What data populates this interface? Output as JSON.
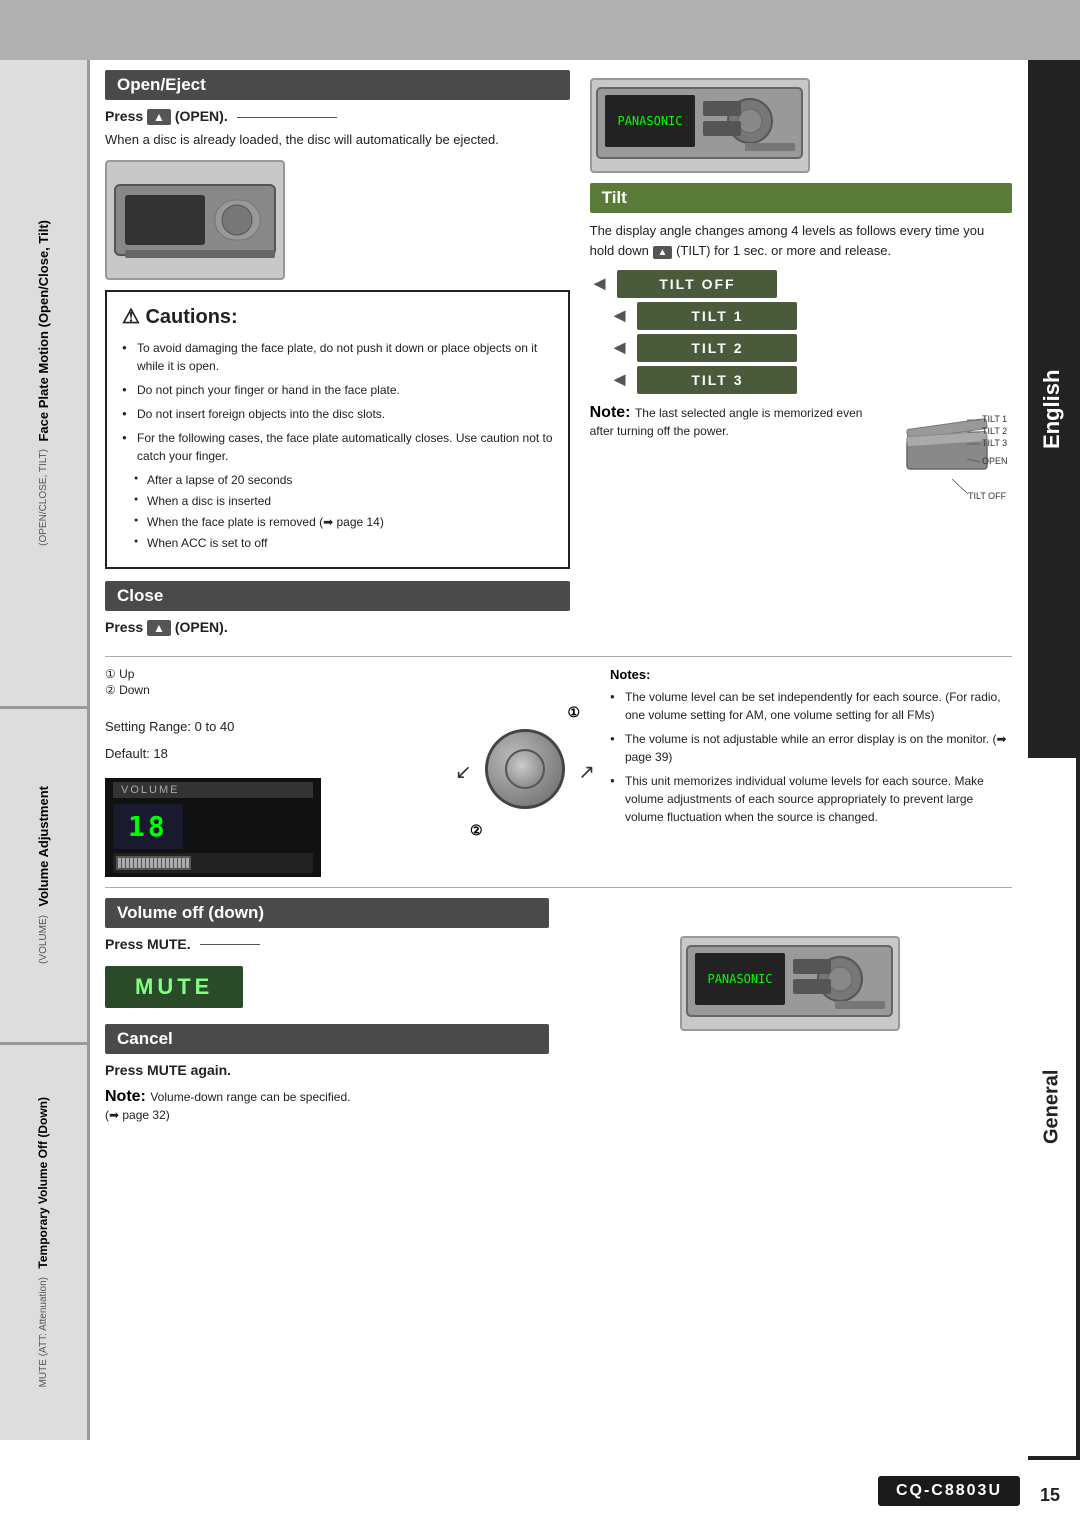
{
  "page": {
    "title": "CQ-C8803U Manual Page 15",
    "page_number": "15",
    "model": "CQ-C8803U"
  },
  "sidebar_right": {
    "english_label": "English",
    "general_label": "General"
  },
  "sidebar_left": {
    "section1_main": "Face Plate Motion (Open/Close, Tilt)",
    "section1_sub": "(OPEN/CLOSE, TILT)",
    "section2_main": "Volume Adjustment",
    "section2_sub": "(VOLUME)",
    "section3_main": "Temporary Volume Off (Down)",
    "section3_sub": "MUTE (ATT: Attenuation)"
  },
  "open_eject": {
    "header": "Open/Eject",
    "press_text": "Press",
    "press_symbol": "▲",
    "press_label": "(OPEN).",
    "body": "When a disc is already loaded, the disc will automatically be ejected."
  },
  "cautions": {
    "title": "⚠ Cautions:",
    "items": [
      "To avoid damaging the face plate, do not push it down or place objects on it while it is open.",
      "Do not pinch your finger or hand in the face plate.",
      "Do not insert foreign objects into the disc slots.",
      "For the following cases, the face plate automatically closes. Use caution not to catch your finger."
    ],
    "sub_items": [
      "After a lapse of 20 seconds",
      "When a disc is inserted",
      "When the face plate is removed (➡ page 14)",
      "When ACC is set to off"
    ]
  },
  "tilt": {
    "header": "Tilt",
    "body": "The display angle changes among 4 levels as follows every time you hold down",
    "body2": "(TILT) for 1 sec. or more and release.",
    "bars": [
      "TILT  OFF",
      "TILT  1",
      "TILT  2",
      "TILT  3"
    ],
    "note_bold": "Note:",
    "note_text": " The last selected angle is memorized even after turning off the power.",
    "tilt_labels": [
      "TILT 1",
      "TILT 2",
      "TILT 3",
      "OPEN",
      "TILT OFF"
    ]
  },
  "close": {
    "header": "Close",
    "press_text": "Press",
    "press_symbol": "▲",
    "press_label": "(OPEN)."
  },
  "volume": {
    "up_label": "① Up",
    "down_label": "② Down",
    "setting_range": "Setting Range: 0 to 40",
    "default": "Default: 18",
    "display_label": "VOLUME",
    "display_value": "18",
    "num1": "①",
    "num2": "②"
  },
  "volume_notes": {
    "bold": "Notes:",
    "items": [
      "The volume level can be set independently for each source. (For radio, one volume setting for AM, one volume setting for all FMs)",
      "The volume is not adjustable while an error display is on the monitor. (➡ page 39)",
      "This unit memorizes individual volume levels for each source. Make volume adjustments of each source appropriately to prevent large volume fluctuation when the source is changed."
    ]
  },
  "volume_off": {
    "header": "Volume off (down)",
    "press_text": "Press",
    "press_bold": "MUTE",
    "press_suffix": ".",
    "display_value": "MUTE"
  },
  "cancel": {
    "header": "Cancel",
    "press_text": "Press",
    "press_bold": "MUTE",
    "press_suffix": " again."
  },
  "note_bottom": {
    "bold": "Note:",
    "text": " Volume-down range can be specified.",
    "page_ref": "(➡ page 32)"
  }
}
